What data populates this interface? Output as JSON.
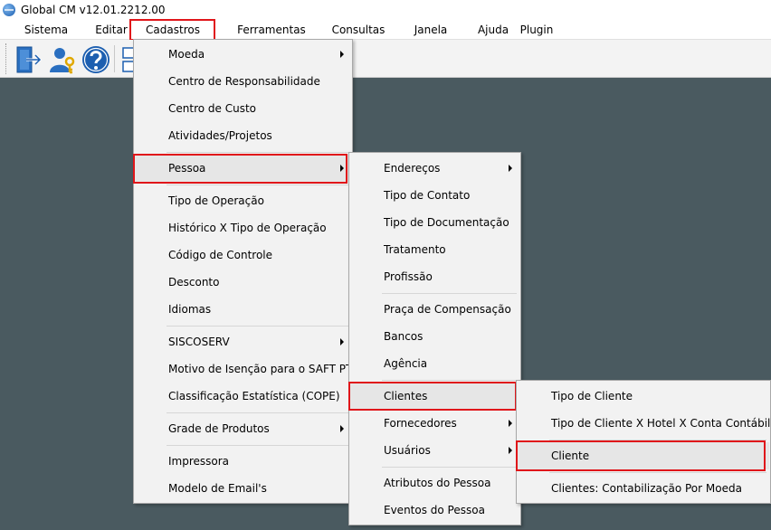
{
  "window": {
    "title": "Global CM v12.01.2212.00"
  },
  "menubar": {
    "items": [
      "Sistema",
      "Editar",
      "Cadastros",
      "Ferramentas",
      "Consultas",
      "Janela",
      "Ajuda",
      "Plugin"
    ]
  },
  "toolbar": {
    "buttons": [
      "exit-door-icon",
      "user-key-icon",
      "help-icon",
      "screen-icon"
    ]
  },
  "menus": {
    "cadastros": {
      "items": [
        "Moeda",
        "Centro de Responsabilidade",
        "Centro de Custo",
        "Atividades/Projetos",
        "Pessoa",
        "Tipo de Operação",
        "Histórico  X Tipo de Operação",
        "Código de Controle",
        "Desconto",
        "Idiomas",
        "SISCOSERV",
        "Motivo de Isenção para o SAFT PT",
        "Classificação Estatística (COPE)",
        "Grade de Produtos",
        "Impressora",
        "Modelo de Email's"
      ]
    },
    "pessoa": {
      "items": [
        "Endereços",
        "Tipo de Contato",
        "Tipo de Documentação",
        "Tratamento",
        "Profissão",
        "Praça de Compensação",
        "Bancos",
        "Agência",
        "Clientes",
        "Fornecedores",
        "Usuários",
        "Atributos do Pessoa",
        "Eventos do Pessoa"
      ]
    },
    "clientes": {
      "items": [
        "Tipo de Cliente",
        "Tipo de Cliente X Hotel X Conta Contábil",
        "Cliente",
        "Clientes: Contabilização Por Moeda"
      ]
    }
  },
  "colors": {
    "highlight_box": "#e0161a",
    "workspace": "#4a5a60",
    "menu_bg": "#f2f2f2"
  }
}
